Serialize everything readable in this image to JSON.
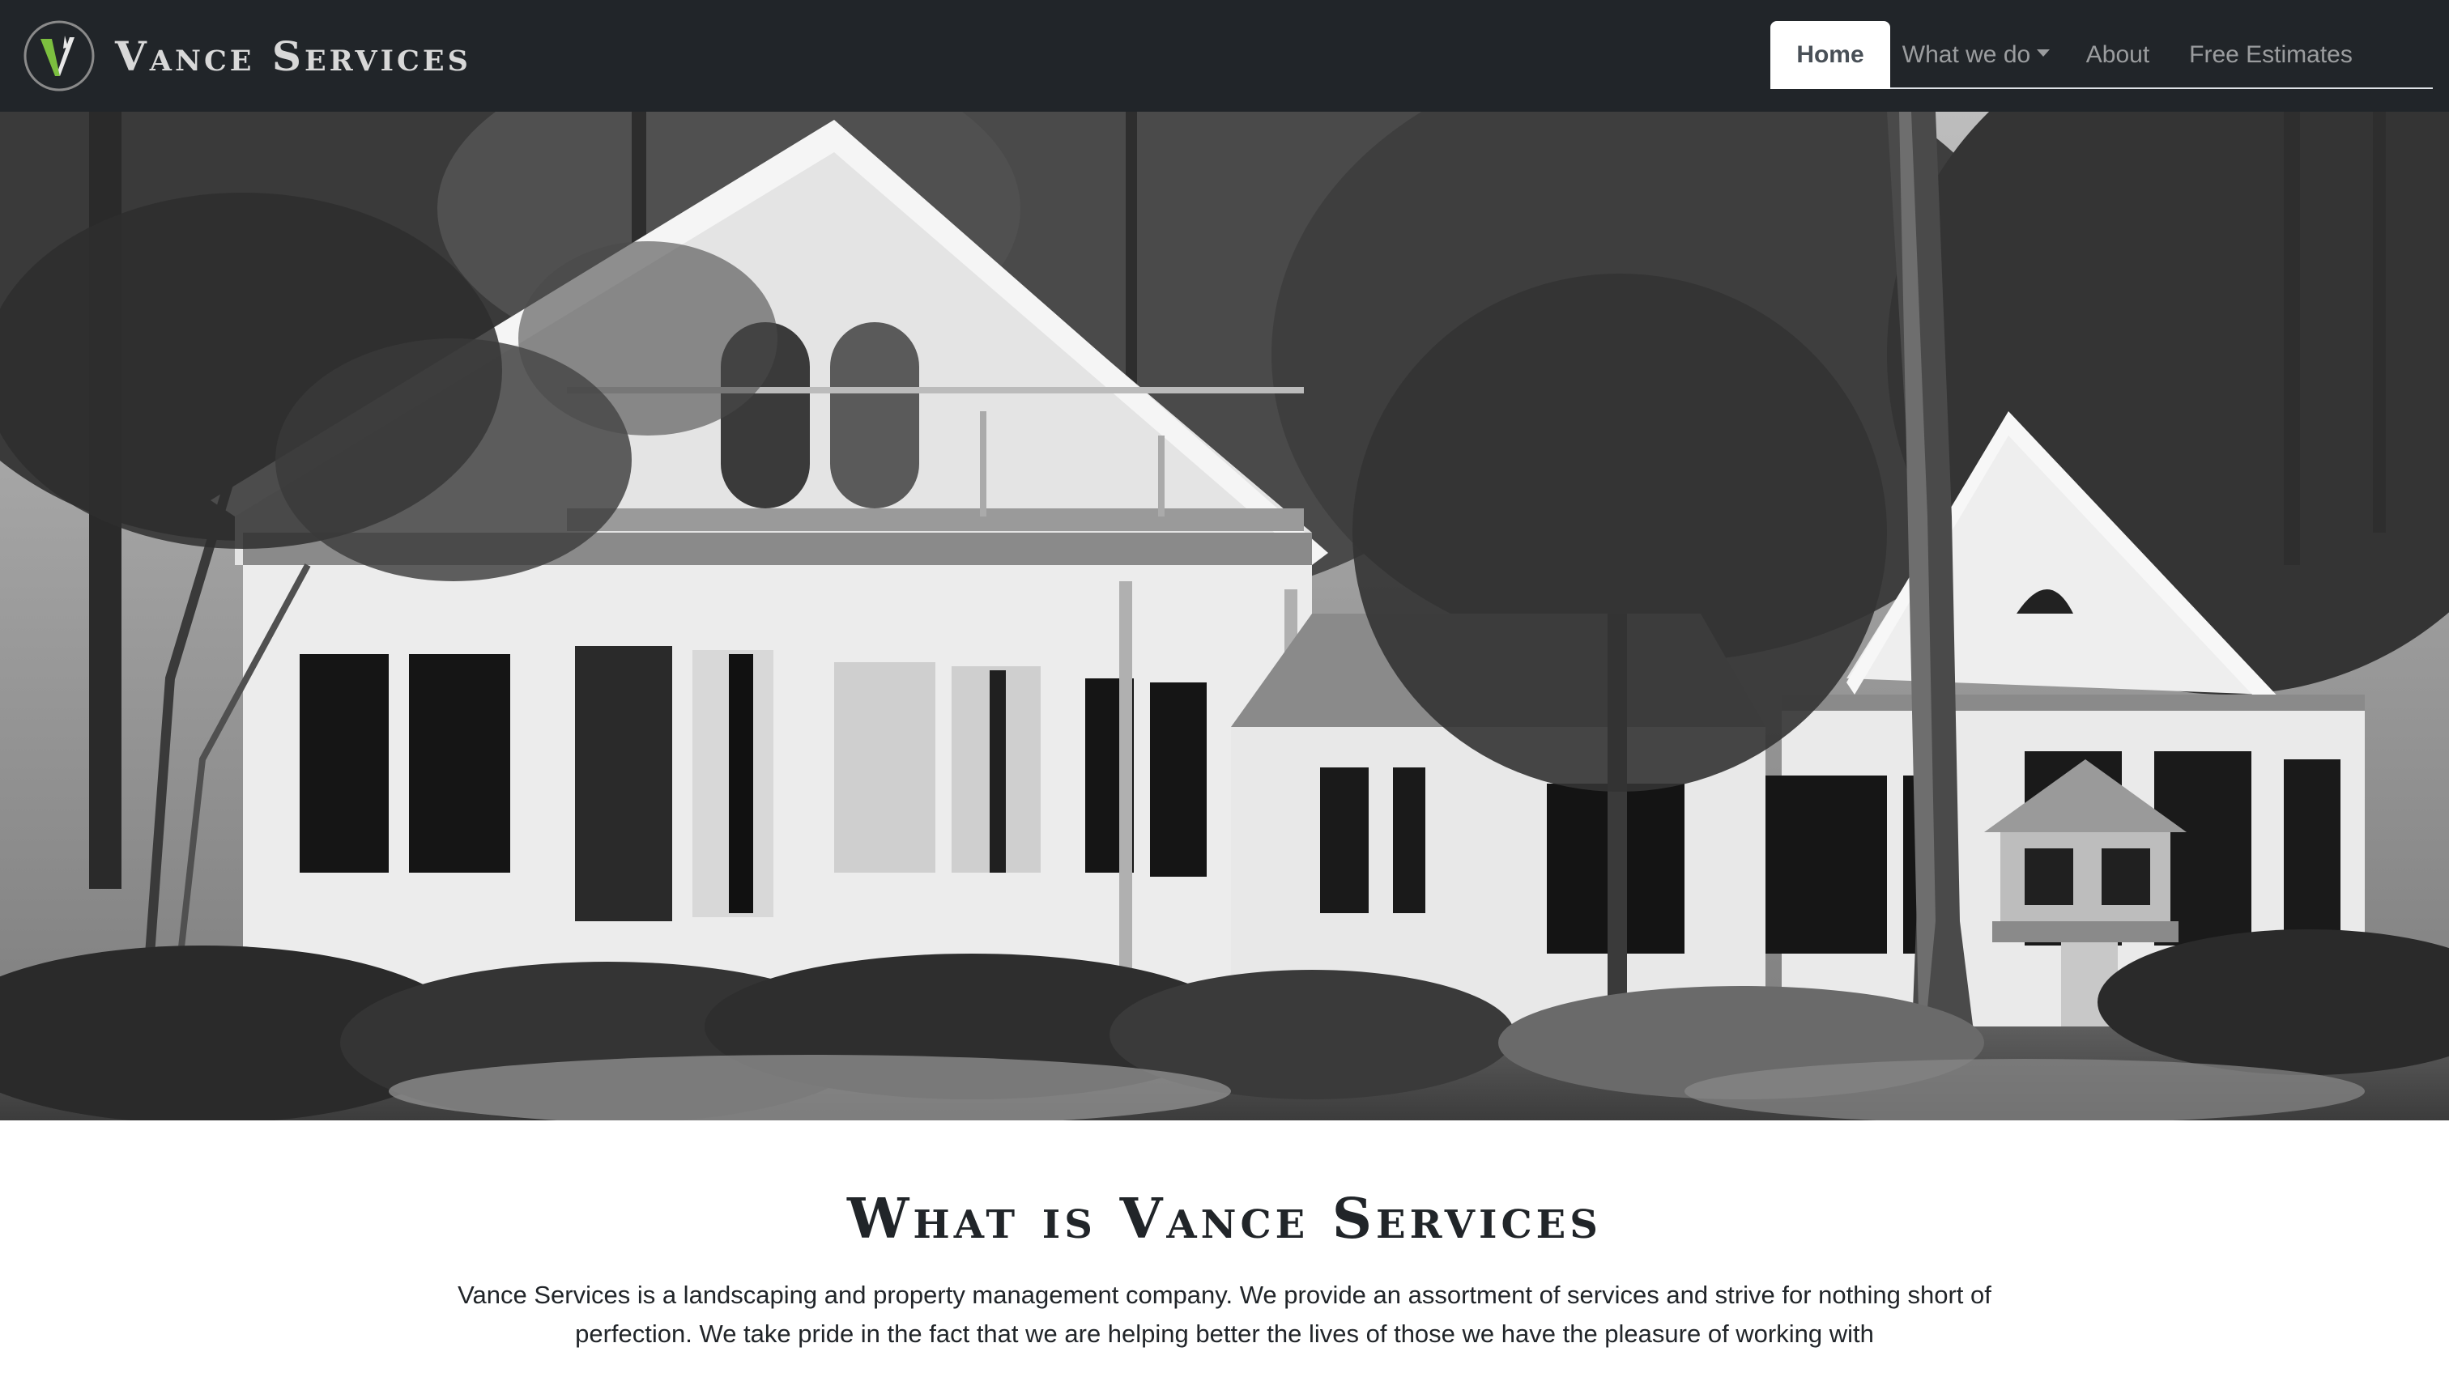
{
  "navbar": {
    "brand": "Vance Services",
    "logo_icon": "vance-v-logo-icon",
    "items": [
      {
        "label": "Home",
        "active": true
      },
      {
        "label": "What we do",
        "dropdown": true
      },
      {
        "label": "About"
      },
      {
        "label": "Free Estimates"
      }
    ]
  },
  "hero": {
    "image": "black-and-white-house-with-trees-photo"
  },
  "main": {
    "title": "What is Vance Services",
    "body": "Vance Services is a landscaping and property management company. We provide an assortment of services and strive for nothing short of perfection. We take pride in the fact that we are helping better the lives of those we have the pleasure of working with"
  },
  "colors": {
    "navbar_bg": "#212529",
    "nav_text": "rgba(255,255,255,0.55)",
    "active_tab_bg": "#ffffff",
    "logo_accent": "#7cbf3f"
  }
}
